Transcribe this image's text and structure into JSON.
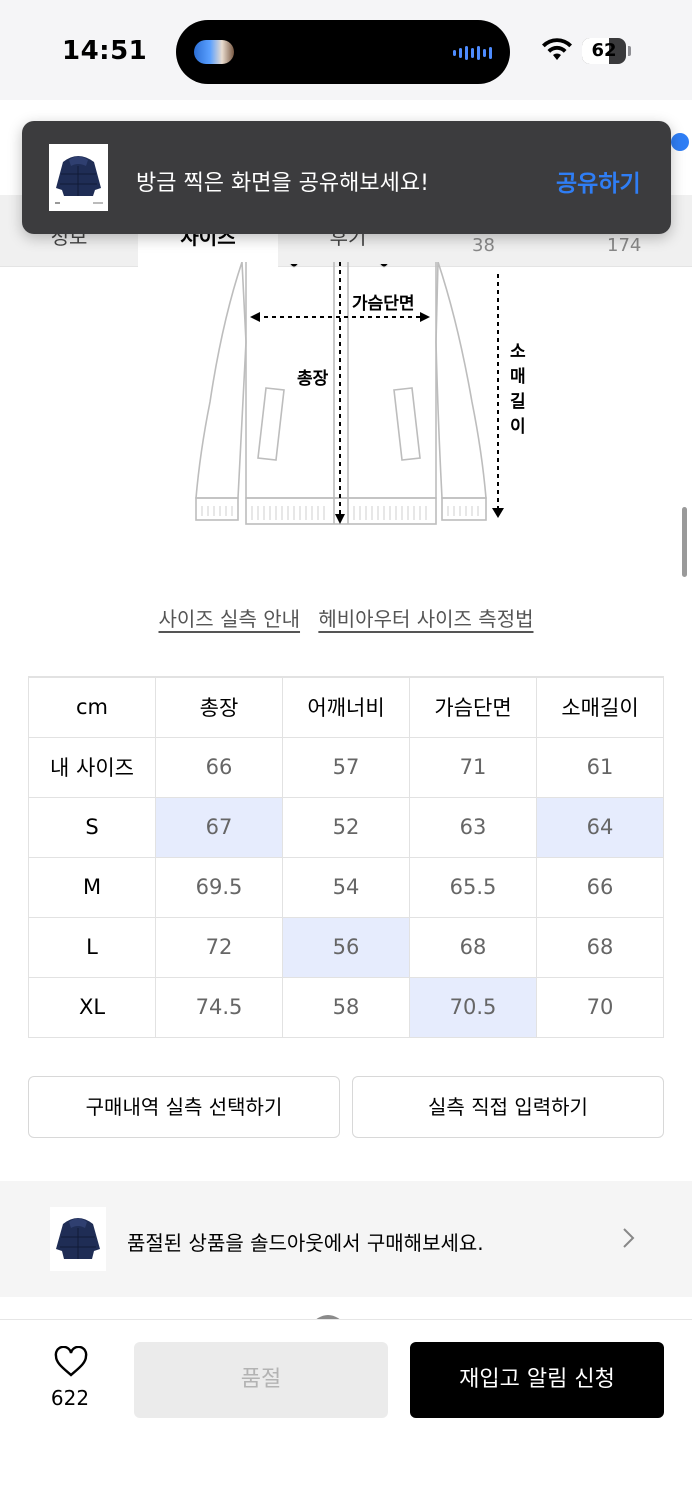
{
  "status_bar": {
    "time": "14:51",
    "battery": "62",
    "battery_level": 0.62
  },
  "toast": {
    "message": "방금 찍은 화면을 공유해보세요!",
    "action": "공유하기"
  },
  "tabs": [
    {
      "label": "정보"
    },
    {
      "label": "사이즈"
    },
    {
      "label": "후기"
    }
  ],
  "tab_extra": [
    "38",
    "174"
  ],
  "diagram": {
    "labels": {
      "chest": "가슴단면",
      "length": "총장",
      "sleeve": "소매길이"
    }
  },
  "links": [
    "사이즈 실측 안내",
    "헤비아우터 사이즈 측정법"
  ],
  "size_table": {
    "headers": [
      "cm",
      "총장",
      "어깨너비",
      "가슴단면",
      "소매길이"
    ],
    "rows": [
      {
        "label": "내 사이즈",
        "values": [
          "66",
          "57",
          "71",
          "61"
        ],
        "highlight": []
      },
      {
        "label": "S",
        "values": [
          "67",
          "52",
          "63",
          "64"
        ],
        "highlight": [
          0,
          3
        ]
      },
      {
        "label": "M",
        "values": [
          "69.5",
          "54",
          "65.5",
          "66"
        ],
        "highlight": []
      },
      {
        "label": "L",
        "values": [
          "72",
          "56",
          "68",
          "68"
        ],
        "highlight": [
          1
        ]
      },
      {
        "label": "XL",
        "values": [
          "74.5",
          "58",
          "70.5",
          "70"
        ],
        "highlight": [
          2
        ]
      }
    ],
    "highlight_color": "#e6ecfd"
  },
  "buttons": {
    "purchase_history": "구매내역 실측 선택하기",
    "manual_input": "실측 직접 입력하기"
  },
  "banner": {
    "text": "품절된 상품을 솔드아웃에서 구매해보세요."
  },
  "bottom_bar": {
    "likes": "622",
    "soldout": "품절",
    "restock_alert": "재입고 알림 신청"
  },
  "colors": {
    "accent": "#2f7ef5",
    "toast_bg": "#3c3c3e",
    "primary_button": "#000000"
  }
}
